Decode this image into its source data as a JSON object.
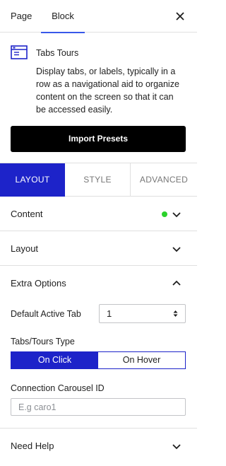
{
  "tabs": {
    "page": "Page",
    "block": "Block"
  },
  "block": {
    "title": "Tabs Tours",
    "description": "Display tabs, or labels, typically in a row as a navigational aid to organize content on the screen so that it can be accessed easily.",
    "import_button": "Import Presets"
  },
  "subtabs": {
    "layout": "LAYOUT",
    "style": "STYLE",
    "advanced": "ADVANCED"
  },
  "panels": {
    "content": "Content",
    "layout": "Layout",
    "extra_options": "Extra Options",
    "need_help": "Need Help"
  },
  "extra_options": {
    "default_active_tab_label": "Default Active Tab",
    "default_active_tab_value": "1",
    "type_label": "Tabs/Tours Type",
    "type_options": [
      "On Click",
      "On Hover"
    ],
    "type_selected": "On Click",
    "carousel_label": "Connection Carousel ID",
    "carousel_placeholder": "E.g caro1"
  },
  "colors": {
    "accent": "#1d23c9",
    "tab_underline": "#3858e9",
    "status_dot": "#2bd22b"
  },
  "icons": {
    "close": "close-icon",
    "block": "tabs-block-icon",
    "chevron": "chevron-icon",
    "select": "select-arrows-icon"
  }
}
